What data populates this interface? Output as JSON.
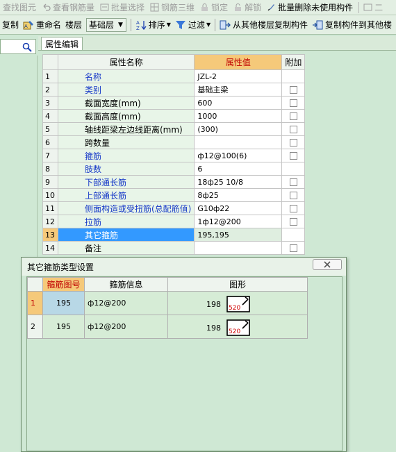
{
  "toolbar_top": {
    "items": [
      "查找图元",
      "查看钢筋量",
      "批量选择",
      "钢筋三维",
      "锁定",
      "解锁",
      "批量删除未使用构件",
      "二"
    ]
  },
  "toolbar_main": {
    "copy": "复制",
    "rename": "重命名",
    "floor_label": "楼层",
    "floor_value": "基础层",
    "sort": "排序",
    "filter": "过滤",
    "copy_from_floor": "从其他楼层复制构件",
    "copy_to_floor": "复制构件到其他楼"
  },
  "tab": {
    "label": "属性编辑"
  },
  "props": {
    "headers": [
      "属性名称",
      "属性值",
      "附加"
    ],
    "rows": [
      {
        "n": "1",
        "name": "名称",
        "value": "JZL-2",
        "blue": true,
        "chk": false
      },
      {
        "n": "2",
        "name": "类别",
        "value": "基础主梁",
        "blue": true,
        "chk": true
      },
      {
        "n": "3",
        "name": "截面宽度(mm)",
        "value": "600",
        "blue": false,
        "chk": true
      },
      {
        "n": "4",
        "name": "截面高度(mm)",
        "value": "1000",
        "blue": false,
        "chk": true
      },
      {
        "n": "5",
        "name": "轴线距梁左边线距离(mm)",
        "value": "(300)",
        "blue": false,
        "chk": true
      },
      {
        "n": "6",
        "name": "跨数量",
        "value": "",
        "blue": false,
        "chk": true
      },
      {
        "n": "7",
        "name": "箍筋",
        "value": "ф12@100(6)",
        "blue": true,
        "chk": true
      },
      {
        "n": "8",
        "name": "肢数",
        "value": "6",
        "blue": true,
        "chk": false
      },
      {
        "n": "9",
        "name": "下部通长筋",
        "value": "18ф25 10/8",
        "blue": true,
        "chk": true
      },
      {
        "n": "10",
        "name": "上部通长筋",
        "value": "8ф25",
        "blue": true,
        "chk": true
      },
      {
        "n": "11",
        "name": "侧面构造或受扭筋(总配筋值)",
        "value": "G10ф22",
        "blue": true,
        "chk": true
      },
      {
        "n": "12",
        "name": "拉筋",
        "value": "1ф12@200",
        "blue": true,
        "chk": true
      },
      {
        "n": "13",
        "name": "其它箍筋",
        "value": "195,195",
        "blue": false,
        "chk": false,
        "selected": true
      },
      {
        "n": "14",
        "name": "备注",
        "value": "",
        "blue": false,
        "chk": true
      }
    ]
  },
  "dialog": {
    "title": "其它箍筋类型设置",
    "headers": [
      "箍筋图号",
      "箍筋信息",
      "图形"
    ],
    "rows": [
      {
        "n": "1",
        "no": "195",
        "info": "ф12@200",
        "dim_a": "198",
        "dim_b": "520"
      },
      {
        "n": "2",
        "no": "195",
        "info": "ф12@200",
        "dim_a": "198",
        "dim_b": "520"
      }
    ]
  },
  "colors": {
    "panel_bg": "#cfe8d4",
    "header_highlight": "#f5c97a",
    "blue_text": "#1638c8",
    "selection": "#3399ff"
  }
}
